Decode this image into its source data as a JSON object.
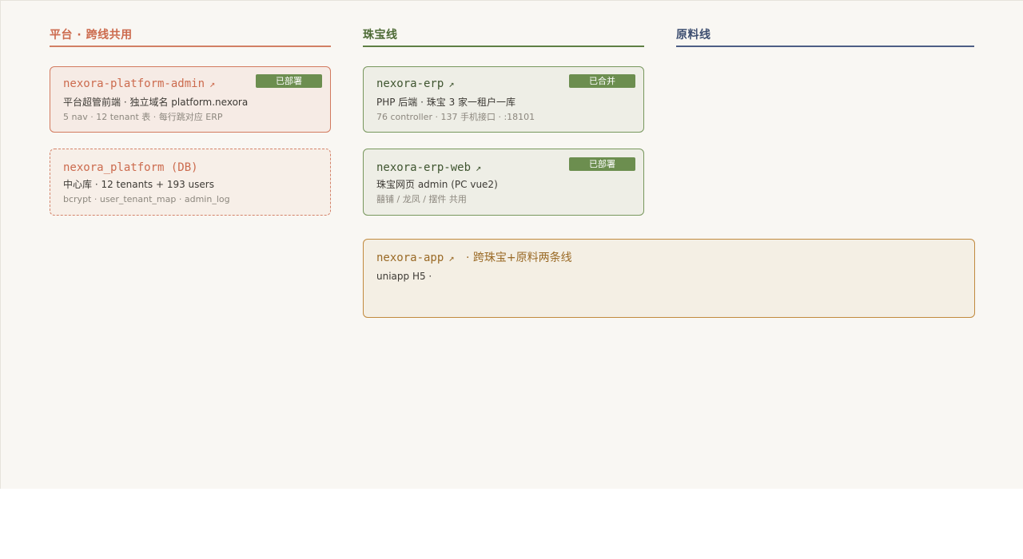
{
  "columns": {
    "platform": {
      "title": "平台 · 跨线共用"
    },
    "jewelry": {
      "title": "珠宝线"
    },
    "raw": {
      "title": "原料线"
    }
  },
  "cards": {
    "platform_admin": {
      "title": "nexora-platform-admin",
      "arrow": "↗",
      "badge": "已部署",
      "line1": "平台超管前端 · 独立域名 platform.nexora",
      "line2": "5 nav · 12 tenant 表 · 每行跳对应 ERP"
    },
    "platform_db": {
      "title": "nexora_platform (DB)",
      "line1": "中心库 · 12 tenants + 193 users",
      "line2": "bcrypt · user_tenant_map · admin_log"
    },
    "erp": {
      "title": "nexora-erp",
      "arrow": "↗",
      "badge": "已合并",
      "line1": "PHP 后端 · 珠宝 3 家一租户一库",
      "line2": "76 controller · 137 手机接口 · :18101"
    },
    "erp_web": {
      "title": "nexora-erp-web",
      "arrow": "↗",
      "badge": "已部署",
      "line1": "珠宝网页 admin (PC vue2)",
      "line2": "囍铺 / 龙凤 / 摆件 共用"
    },
    "app": {
      "title": "nexora-app",
      "arrow": "↗",
      "extra": "· 跨珠宝+原料两条线",
      "line1": "uniapp H5 ·"
    }
  },
  "colors": {
    "platform": "#cc6b4e",
    "jewelry": "#4e6b36",
    "raw": "#3d4e70",
    "app": "#9a6a26",
    "badge": "#6c8e4f"
  }
}
